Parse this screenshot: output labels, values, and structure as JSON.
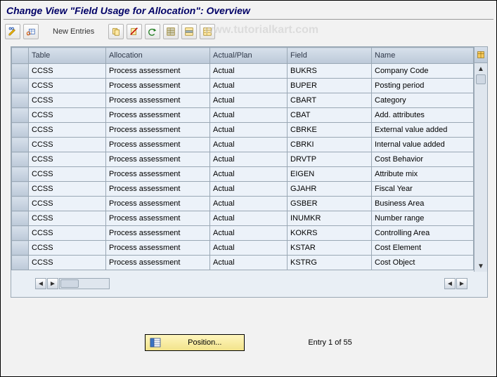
{
  "title": "Change View \"Field Usage for Allocation\": Overview",
  "toolbar": {
    "new_entries_label": "New Entries"
  },
  "watermark": "www.tutorialkart.com",
  "columns": {
    "table": "Table",
    "allocation": "Allocation",
    "actual_plan": "Actual/Plan",
    "field": "Field",
    "name": "Name"
  },
  "rows": [
    {
      "table": "CCSS",
      "allocation": "Process assessment",
      "actual_plan": "Actual",
      "field": "BUKRS",
      "name": "Company Code"
    },
    {
      "table": "CCSS",
      "allocation": "Process assessment",
      "actual_plan": "Actual",
      "field": "BUPER",
      "name": "Posting period"
    },
    {
      "table": "CCSS",
      "allocation": "Process assessment",
      "actual_plan": "Actual",
      "field": "CBART",
      "name": "Category"
    },
    {
      "table": "CCSS",
      "allocation": "Process assessment",
      "actual_plan": "Actual",
      "field": "CBAT",
      "name": "Add. attributes"
    },
    {
      "table": "CCSS",
      "allocation": "Process assessment",
      "actual_plan": "Actual",
      "field": "CBRKE",
      "name": "External value added"
    },
    {
      "table": "CCSS",
      "allocation": "Process assessment",
      "actual_plan": "Actual",
      "field": "CBRKI",
      "name": "Internal value added"
    },
    {
      "table": "CCSS",
      "allocation": "Process assessment",
      "actual_plan": "Actual",
      "field": "DRVTP",
      "name": "Cost Behavior"
    },
    {
      "table": "CCSS",
      "allocation": "Process assessment",
      "actual_plan": "Actual",
      "field": "EIGEN",
      "name": "Attribute mix"
    },
    {
      "table": "CCSS",
      "allocation": "Process assessment",
      "actual_plan": "Actual",
      "field": "GJAHR",
      "name": "Fiscal Year"
    },
    {
      "table": "CCSS",
      "allocation": "Process assessment",
      "actual_plan": "Actual",
      "field": "GSBER",
      "name": "Business Area"
    },
    {
      "table": "CCSS",
      "allocation": "Process assessment",
      "actual_plan": "Actual",
      "field": "INUMKR",
      "name": "Number range"
    },
    {
      "table": "CCSS",
      "allocation": "Process assessment",
      "actual_plan": "Actual",
      "field": "KOKRS",
      "name": "Controlling Area"
    },
    {
      "table": "CCSS",
      "allocation": "Process assessment",
      "actual_plan": "Actual",
      "field": "KSTAR",
      "name": "Cost Element"
    },
    {
      "table": "CCSS",
      "allocation": "Process assessment",
      "actual_plan": "Actual",
      "field": "KSTRG",
      "name": "Cost Object"
    }
  ],
  "footer": {
    "position_label": "Position...",
    "entry_text": "Entry 1 of 55"
  }
}
